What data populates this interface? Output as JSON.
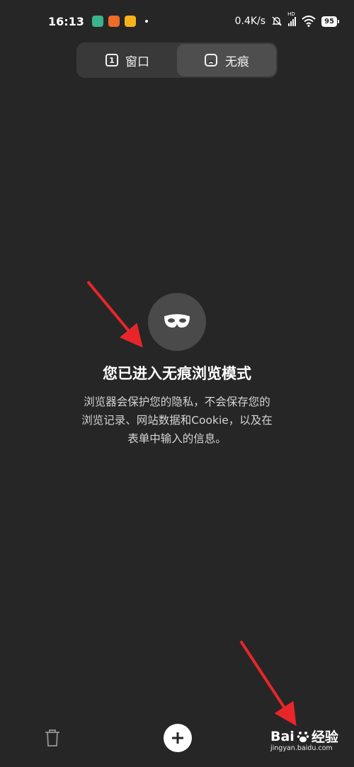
{
  "status": {
    "time": "16:13",
    "speed": "0.4K/s",
    "network_badge": "HD",
    "battery": "95"
  },
  "tabs": [
    {
      "label": "窗口",
      "count": "1",
      "active": false
    },
    {
      "label": "无痕",
      "active": true
    }
  ],
  "incognito": {
    "icon": "mask-icon",
    "title": "您已进入无痕浏览模式",
    "description_lines": [
      "浏览器会保护您的隐私，不会保存您的",
      "浏览记录、网站数据和Cookie，以及在",
      "表单中输入的信息。"
    ]
  },
  "bottom_bar": {
    "icons": [
      "trash-icon",
      "add-icon"
    ]
  },
  "watermark": {
    "brand": "Bai",
    "brand_suffix": "经验",
    "url": "jingyan.baidu.com"
  },
  "colors": {
    "background": "#262626",
    "tab_bg": "#393939",
    "tab_active": "#4e4e4e",
    "annotation_arrow": "#e8262a"
  }
}
